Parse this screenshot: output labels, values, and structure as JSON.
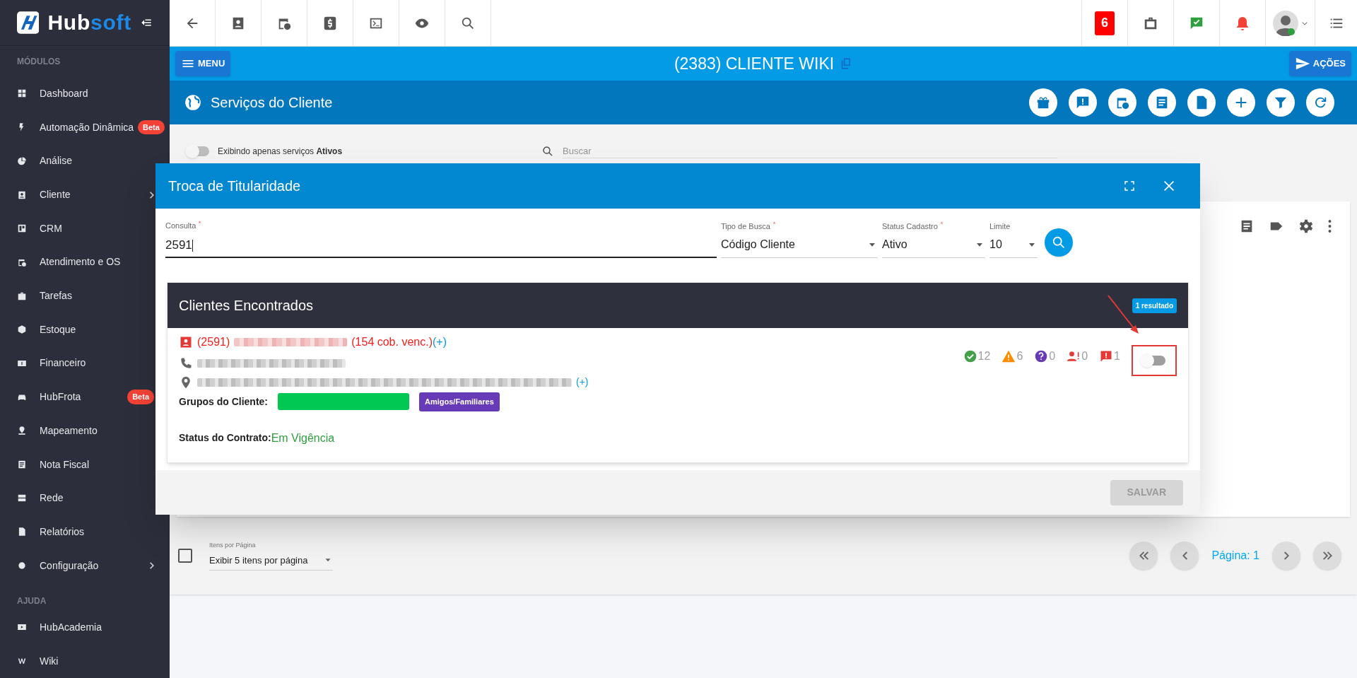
{
  "sidebar": {
    "logo": [
      "Hub",
      "soft"
    ],
    "sections": [
      {
        "title": "MÓDULOS",
        "items": [
          {
            "label": "Dashboard"
          },
          {
            "label": "Automação Dinâmica",
            "badge": "Beta"
          },
          {
            "label": "Análise"
          },
          {
            "label": "Cliente",
            "submenu": true
          },
          {
            "label": "CRM"
          },
          {
            "label": "Atendimento e OS"
          },
          {
            "label": "Tarefas"
          },
          {
            "label": "Estoque"
          },
          {
            "label": "Financeiro"
          },
          {
            "label": "HubFrota",
            "badge": "Beta"
          },
          {
            "label": "Mapeamento"
          },
          {
            "label": "Nota Fiscal"
          },
          {
            "label": "Rede"
          },
          {
            "label": "Relatórios"
          },
          {
            "label": "Configuração",
            "submenu": true
          }
        ]
      },
      {
        "title": "AJUDA",
        "items": [
          {
            "label": "HubAcademia"
          },
          {
            "label": "Wiki"
          }
        ]
      }
    ]
  },
  "topbar": {
    "notification_count": "6"
  },
  "client_bar": {
    "menu": "MENU",
    "title": "(2383) CLIENTE WIKI",
    "actions": "AÇÕES"
  },
  "section": {
    "title": "Serviços do Cliente"
  },
  "filter": {
    "label": "Exibindo apenas serviços **Ativos**",
    "on": false,
    "search_placeholder": "Buscar"
  },
  "modal": {
    "title": "Troca de Titularidade",
    "fields": [
      {
        "kind": "text",
        "label": "Consulta",
        "required": true,
        "value": "2591"
      },
      {
        "kind": "select",
        "label": "Tipo de Busca",
        "required": true,
        "value": "Código Cliente"
      },
      {
        "kind": "select",
        "label": "Status Cadastro",
        "required": true,
        "value": "Ativo"
      },
      {
        "kind": "select",
        "label": "Limite",
        "required": false,
        "value": "10"
      }
    ],
    "results": {
      "title": "Clientes Encontrados",
      "count": "1 resultado",
      "client": {
        "code": "(2591)",
        "overdue": "(154 cob. venc.)",
        "more": "(+)",
        "address_more": "(+)",
        "groups_label": "Grupos do Cliente:",
        "groups": [
          {
            "kind": "redacted",
            "color": "#00c853"
          },
          {
            "kind": "tag",
            "label": "Amigos/Familiares",
            "color": "#673ab7"
          }
        ],
        "status_label": "Status do Contrato:",
        "status": "Em Vigência",
        "counters": [
          {
            "value": "12",
            "color": "#43a047"
          },
          {
            "value": "6",
            "color": "#fb8c00"
          },
          {
            "value": "0",
            "color": "#673ab7"
          },
          {
            "value": "0",
            "color": "#e53935"
          },
          {
            "value": "1",
            "color": "#e53935"
          }
        ],
        "selected": false,
        "highlighted": true
      }
    },
    "save": {
      "label": "SALVAR",
      "disabled": true
    }
  },
  "pagination": {
    "select_all_checked": false,
    "per_page_label": "Itens por Página",
    "per_page": "Exibir 5 itens por página",
    "page": "Página: 1"
  }
}
